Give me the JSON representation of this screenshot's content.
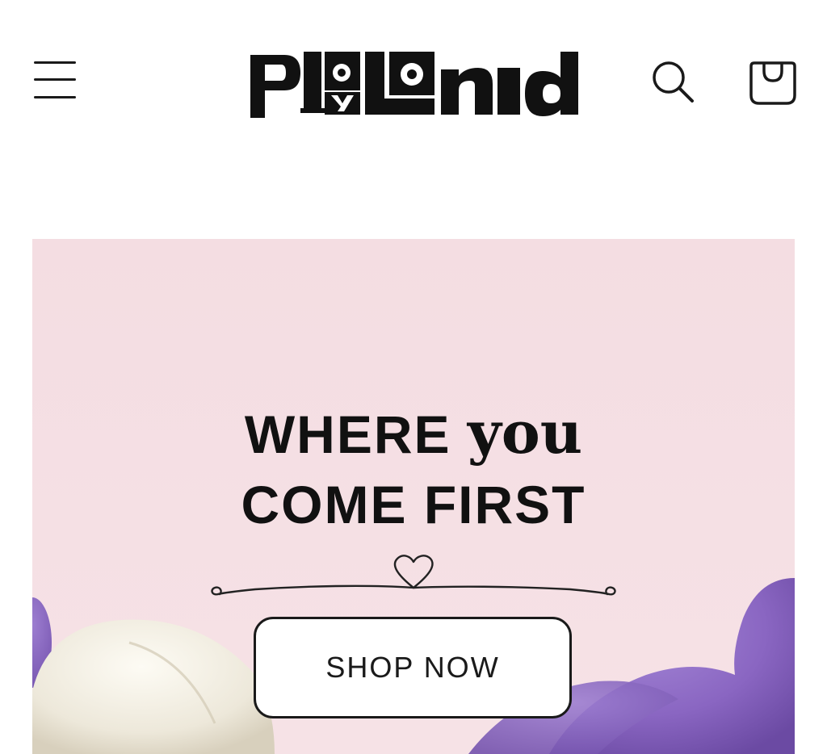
{
  "header": {
    "logo_text": "playland",
    "menu_icon": "hamburger-menu-icon",
    "search_icon": "search-icon",
    "cart_icon": "shopping-bag-icon"
  },
  "hero": {
    "headline_word_1": "WHERE",
    "headline_accent": "you",
    "headline_line_2": "COME FIRST",
    "flourish_icon": "heart-flourish-icon",
    "cta_label": "SHOP NOW",
    "background_color": "#f5dde2"
  },
  "colors": {
    "text": "#111111",
    "background": "#ffffff",
    "hero_pink": "#f5dde2",
    "accent_purple": "#8e6bc4",
    "cream": "#f4f1e8"
  }
}
